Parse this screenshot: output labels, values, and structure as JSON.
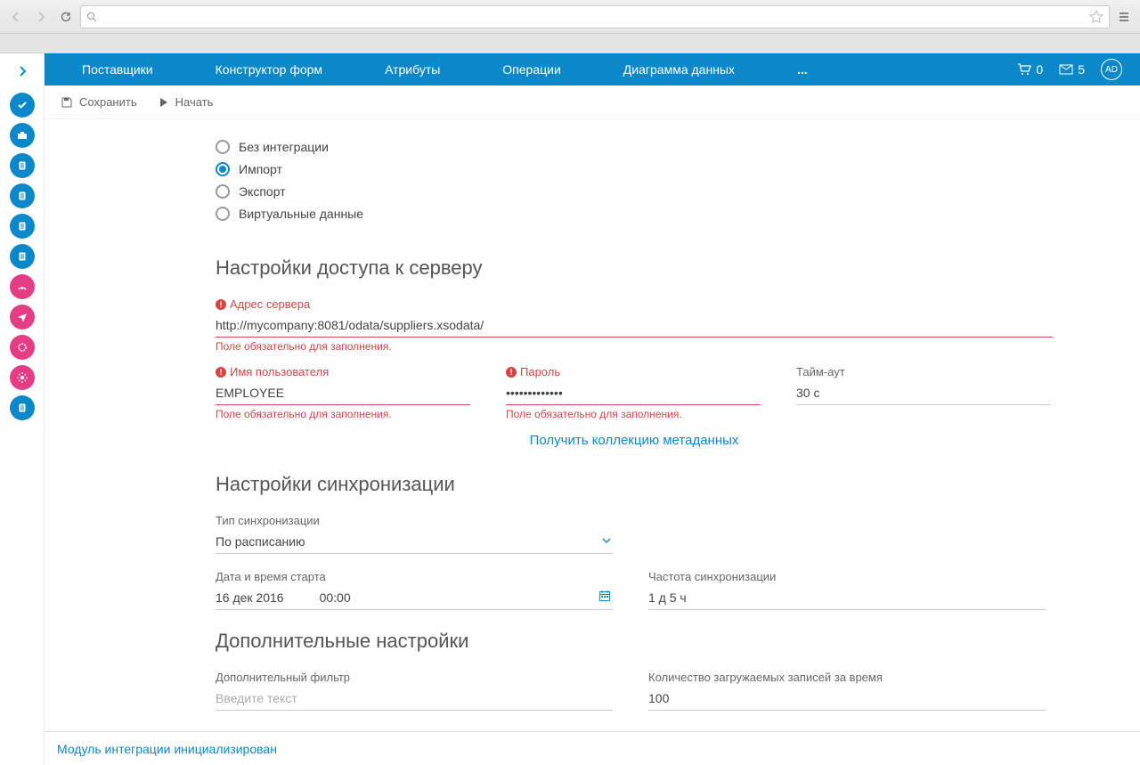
{
  "browser": {
    "url": ""
  },
  "topnav": {
    "items": [
      "Поставщики",
      "Конструктор форм",
      "Атрибуты",
      "Операции",
      "Диаграмма данных"
    ],
    "more": "...",
    "cart_count": "0",
    "mail_count": "5",
    "avatar": "AD"
  },
  "actions": {
    "save": "Сохранить",
    "start": "Начать"
  },
  "integration_mode": {
    "options": [
      "Без интеграции",
      "Импорт",
      "Экспорт",
      "Виртуальные данные"
    ],
    "selected_index": 1
  },
  "sections": {
    "server": "Настройки доступа к серверу",
    "sync": "Настройки синхронизации",
    "extra": "Дополнительные настройки"
  },
  "fields": {
    "address_label": "Адрес сервера",
    "address_value": "http://mycompany:8081/odata/suppliers.xsodata/",
    "required_msg": "Поле обязательно для заполнения.",
    "username_label": "Имя пользователя",
    "username_value": "EMPLOYEE",
    "password_label": "Пароль",
    "password_value": "•••••••••••••",
    "timeout_label": "Тайм-аут",
    "timeout_value": "30 с",
    "metadata_link": "Получить коллекцию метаданных",
    "sync_type_label": "Тип синхронизации",
    "sync_type_value": "По расписанию",
    "start_dt_label": "Дата и время старта",
    "start_date": "16 дек 2016",
    "start_time": "00:00",
    "sync_freq_label": "Частота синхронизации",
    "sync_freq_value": "1 д 5 ч",
    "filter_label": "Дополнительный фильтр",
    "filter_placeholder": "Введите текст",
    "batch_label": "Количество загружаемых записей за время",
    "batch_value": "100"
  },
  "footer": {
    "status": "Модуль интеграции инициализирован"
  }
}
